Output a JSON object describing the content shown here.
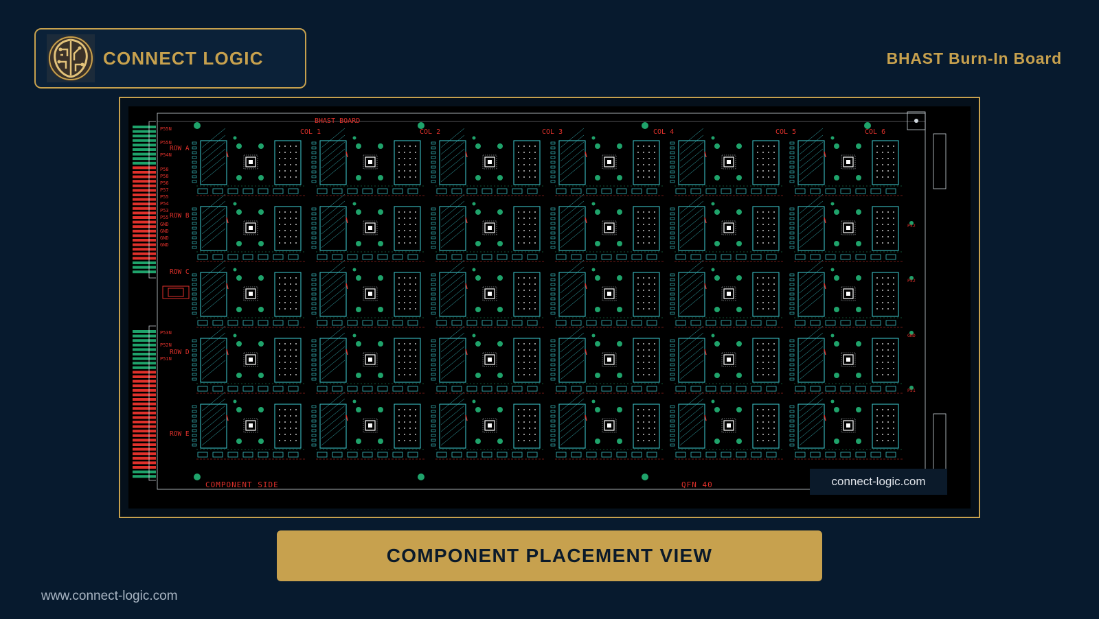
{
  "header": {
    "brand_name": "CONNECT LOGIC",
    "logo_icon": "circuit-brain-logo",
    "board_title": "BHAST Burn-In Board"
  },
  "pcb": {
    "board_label": "BHAST BOARD",
    "columns": [
      "COL 1",
      "COL 2",
      "COL 3",
      "COL 4",
      "COL 5",
      "COL 6"
    ],
    "rows": [
      "ROW A",
      "ROW B",
      "ROW C",
      "ROW D",
      "ROW E"
    ],
    "left_net_labels": [
      "P55N",
      "P55N",
      "P54N",
      "P58",
      "P58",
      "P56",
      "P57",
      "P55",
      "P54",
      "P53",
      "P55",
      "GND",
      "GND",
      "GND",
      "GND"
    ],
    "lower_net_labels": [
      "P53N",
      "P52N",
      "P51N"
    ],
    "right_net_labels": [
      "P52",
      "P52",
      "GND",
      "P51"
    ],
    "bottom_left_label": "COMPONENT SIDE",
    "bottom_mid_label": "QFN 40",
    "watermark": "connect-logic.com"
  },
  "caption": "COMPONENT PLACEMENT VIEW",
  "footer_url": "www.connect-logic.com",
  "colors": {
    "background": "#071a2e",
    "gold": "#c7a14e",
    "pcb_red": "#e0312b",
    "pcb_cyan": "#3bbfc4",
    "pcb_green": "#1fa36b"
  }
}
